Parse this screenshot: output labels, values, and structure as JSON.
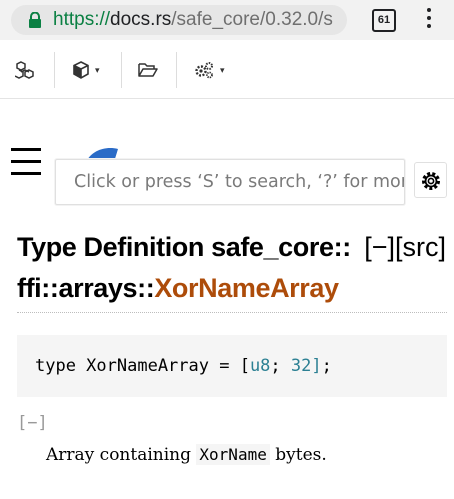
{
  "browser": {
    "url_scheme": "https://",
    "url_host": "docs.rs",
    "url_path": "/safe_core/0.32.0/s",
    "tab_count": "61"
  },
  "docs_toolbar": {
    "items": [
      {
        "icon": "cubes-icon"
      },
      {
        "icon": "cube-icon",
        "has_dropdown": true
      },
      {
        "icon": "folder-open-icon"
      },
      {
        "icon": "cogs-icon",
        "has_dropdown": true
      }
    ],
    "caret": "▾"
  },
  "search": {
    "placeholder": "Click or press ‘S’ to search, ‘?’ for more options…"
  },
  "heading": {
    "kind": "Type Definition",
    "path_line1": "safe_core::",
    "path_line2": "ffi::arrays::",
    "type_name": "XorNameArray",
    "collapse_label": "[−]",
    "src_label": "[src]"
  },
  "code": {
    "prefix": "type XorNameArray = [",
    "type": "u8",
    "sep": "; ",
    "size": "32",
    "suffix": "];"
  },
  "docblock": {
    "toggle": "[−]",
    "text_before": "Array containing ",
    "code": "XorName",
    "text_after": " bytes."
  },
  "colors": {
    "type_name": "#ad4c0a",
    "code_type": "#2c8093",
    "https_green": "#0b8043"
  }
}
